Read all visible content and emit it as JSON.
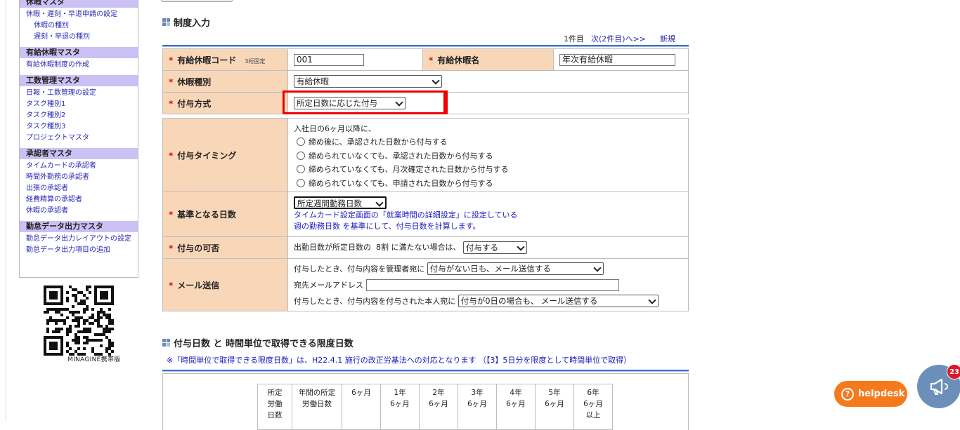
{
  "sidebar": {
    "sections": [
      {
        "title": "休暇マスタ",
        "items": [
          {
            "label": "休暇・遅刻・早退申請の設定",
            "sub": false
          },
          {
            "label": "休暇の種別",
            "sub": true
          },
          {
            "label": "遅刻・早退の種別",
            "sub": true
          }
        ]
      },
      {
        "title": "有給休暇マスタ",
        "items": [
          {
            "label": "有給休暇制度の作成",
            "sub": false
          }
        ]
      },
      {
        "title": "工数管理マスタ",
        "items": [
          {
            "label": "日報・工数管理の設定",
            "sub": false
          },
          {
            "label": "タスク種別1",
            "sub": false
          },
          {
            "label": "タスク種別2",
            "sub": false
          },
          {
            "label": "タスク種別3",
            "sub": false
          },
          {
            "label": "プロジェクトマスタ",
            "sub": false
          }
        ]
      },
      {
        "title": "承認者マスタ",
        "items": [
          {
            "label": "タイムカードの承認者",
            "sub": false
          },
          {
            "label": "時間外勤務の承認者",
            "sub": false
          },
          {
            "label": "出張の承認者",
            "sub": false
          },
          {
            "label": "経費精算の承認者",
            "sub": false
          },
          {
            "label": "休暇の承認者",
            "sub": false
          }
        ]
      },
      {
        "title": "勤怠データ出力マスタ",
        "items": [
          {
            "label": "勤怠データ出力レイアウトの設定",
            "sub": false
          },
          {
            "label": "勤怠データ出力項目の追加",
            "sub": false
          }
        ]
      }
    ],
    "qr_caption": "MINAGINE携帯版"
  },
  "section1": {
    "title": "制度入力",
    "pager": {
      "count": "1件目",
      "next": "次(2件目)へ>>",
      "new": "新規"
    }
  },
  "form": {
    "required_mark": "*",
    "code": {
      "label": "有給休暇コード",
      "note": "3桁固定",
      "value": "001"
    },
    "name": {
      "label": "有給休暇名",
      "value": "年次有給休暇"
    },
    "type": {
      "label": "休暇種別",
      "selected": "有給休暇"
    },
    "method": {
      "label": "付与方式",
      "selected": "所定日数に応じた付与"
    },
    "timing": {
      "label": "付与タイミング",
      "intro": "入社日の6ヶ月以降に、",
      "options": [
        "締め後に、承認された日数から付与する",
        "締められていなくても、承認された日数から付与する",
        "締められていなくても、月次確定された日数から付与する",
        "締められていなくても、申請された日数から付与する"
      ]
    },
    "basis": {
      "label": "基準となる日数",
      "selected": "所定週間勤務日数",
      "desc1": "タイムカード設定画面の「就業時間の詳細設定」に設定している",
      "desc2": "週の勤務日数 を基準にして、付与日数を計算します。"
    },
    "grant": {
      "label": "付与の可否",
      "text_before": "出勤日数が所定日数の",
      "ratio": "8割",
      "text_after": "に満たない場合は、",
      "selected": "付与する"
    },
    "mail": {
      "label": "メール送信",
      "admin_text": "付与したとき、付与内容を管理者宛に",
      "admin_selected": "付与がない日も、メール送信する",
      "address_label": "宛先メールアドレス",
      "address_value": "",
      "self_text": "付与したとき、付与内容を付与された本人宛に",
      "self_selected": "付与が0日の場合も、 メール送信する"
    }
  },
  "section2": {
    "title": "付与日数 と 時間単位で取得できる限度日数",
    "notice": "※「時間単位で取得できる限度日数」は、H22.4.1 施行の改正労基法への対応となります （【3】5日分を限度として時間単位で取得）"
  },
  "days_table": {
    "headers": [
      "所定\n労働\n日数",
      "年間の所定\n労働日数",
      "6ヶ月",
      "1年\n6ヶ月",
      "2年\n6ヶ月",
      "3年\n6ヶ月",
      "4年\n6ヶ月",
      "5年\n6ヶ月",
      "6年\n6ヶ月\n以上"
    ]
  },
  "helpdesk": {
    "label": "helpdesk"
  },
  "notifications": {
    "count": "23"
  }
}
